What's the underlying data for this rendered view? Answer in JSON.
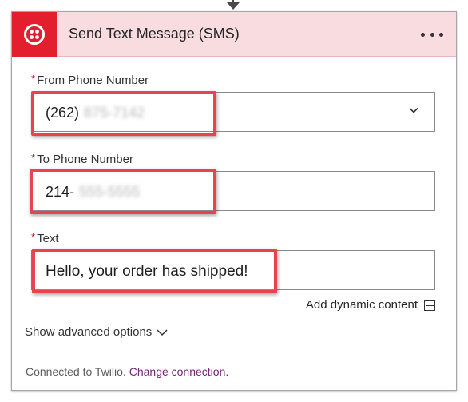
{
  "header": {
    "title": "Send Text Message (SMS)",
    "brand_icon": "twilio-logo-icon",
    "more_icon": "more-options-icon",
    "brand_color": "#e31e2f",
    "header_bg": "#f8dce0"
  },
  "fields": {
    "from": {
      "required_mark": "*",
      "label": "From Phone Number",
      "value_visible": "(262)",
      "value_obscured": "875-7142",
      "dropdown_icon": "chevron-down-icon"
    },
    "to": {
      "required_mark": "*",
      "label": "To Phone Number",
      "value_visible": "214-",
      "value_obscured": "555-5555"
    },
    "text": {
      "required_mark": "*",
      "label": "Text",
      "value": "Hello, your order has shipped!"
    }
  },
  "dynamic_content": {
    "label": "Add dynamic content",
    "icon": "add-box-icon"
  },
  "advanced": {
    "label": "Show advanced options",
    "icon": "chevron-down-icon"
  },
  "footer": {
    "connected_text": "Connected to Twilio.",
    "change_link": "Change connection."
  },
  "colors": {
    "highlight": "#e8434f",
    "link": "#742774",
    "required": "#c50f1f"
  }
}
